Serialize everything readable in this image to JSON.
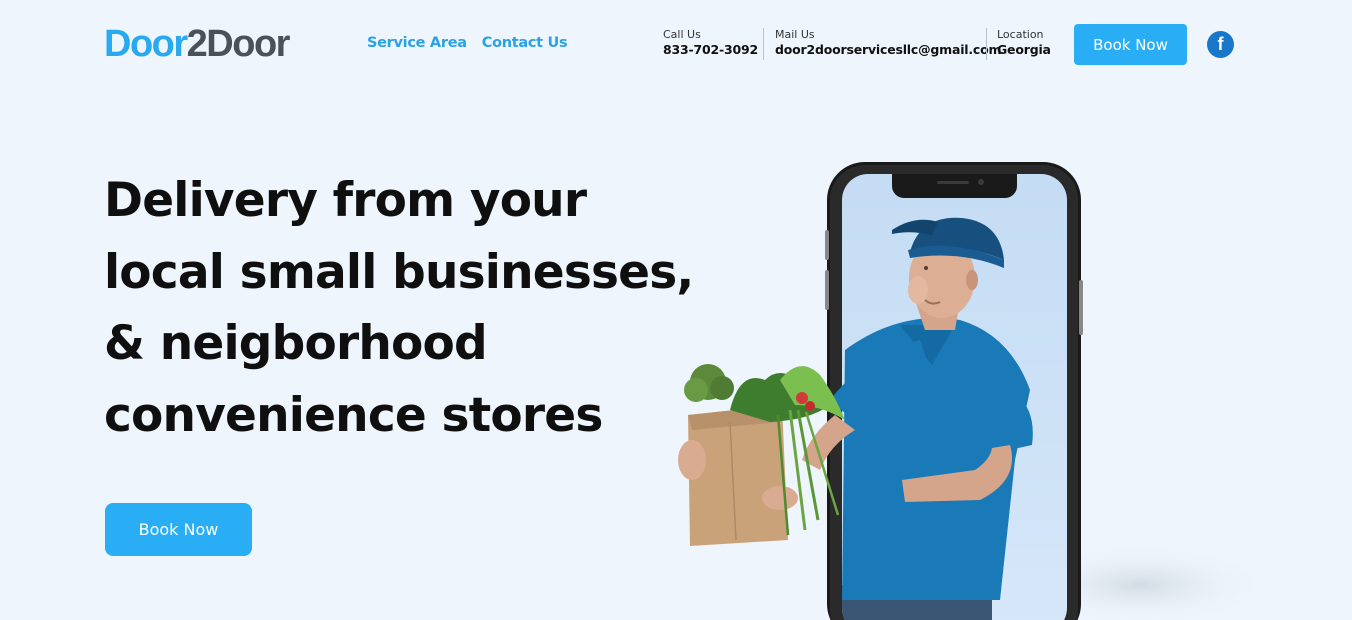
{
  "header": {
    "logo_part1": "Door",
    "logo_part2": "2Door",
    "nav": [
      "Service Area",
      "Contact Us"
    ],
    "call_label": "Call Us",
    "call_value": "833-702-3092",
    "mail_label": "Mail Us",
    "mail_value": "door2doorservicesllc@gmail.com",
    "location_label": "Location",
    "location_value": "Georgia",
    "book_label": "Book Now",
    "facebook_glyph": "f"
  },
  "hero": {
    "lines": [
      "Delivery from your",
      "local small businesses,",
      "& neigborhood",
      "convenience stores"
    ],
    "book_label": "Book Now"
  },
  "colors": {
    "accent": "#29aef5",
    "background": "#eef5fc",
    "facebook": "#1877c8"
  },
  "icons": {
    "social": "facebook-icon"
  }
}
